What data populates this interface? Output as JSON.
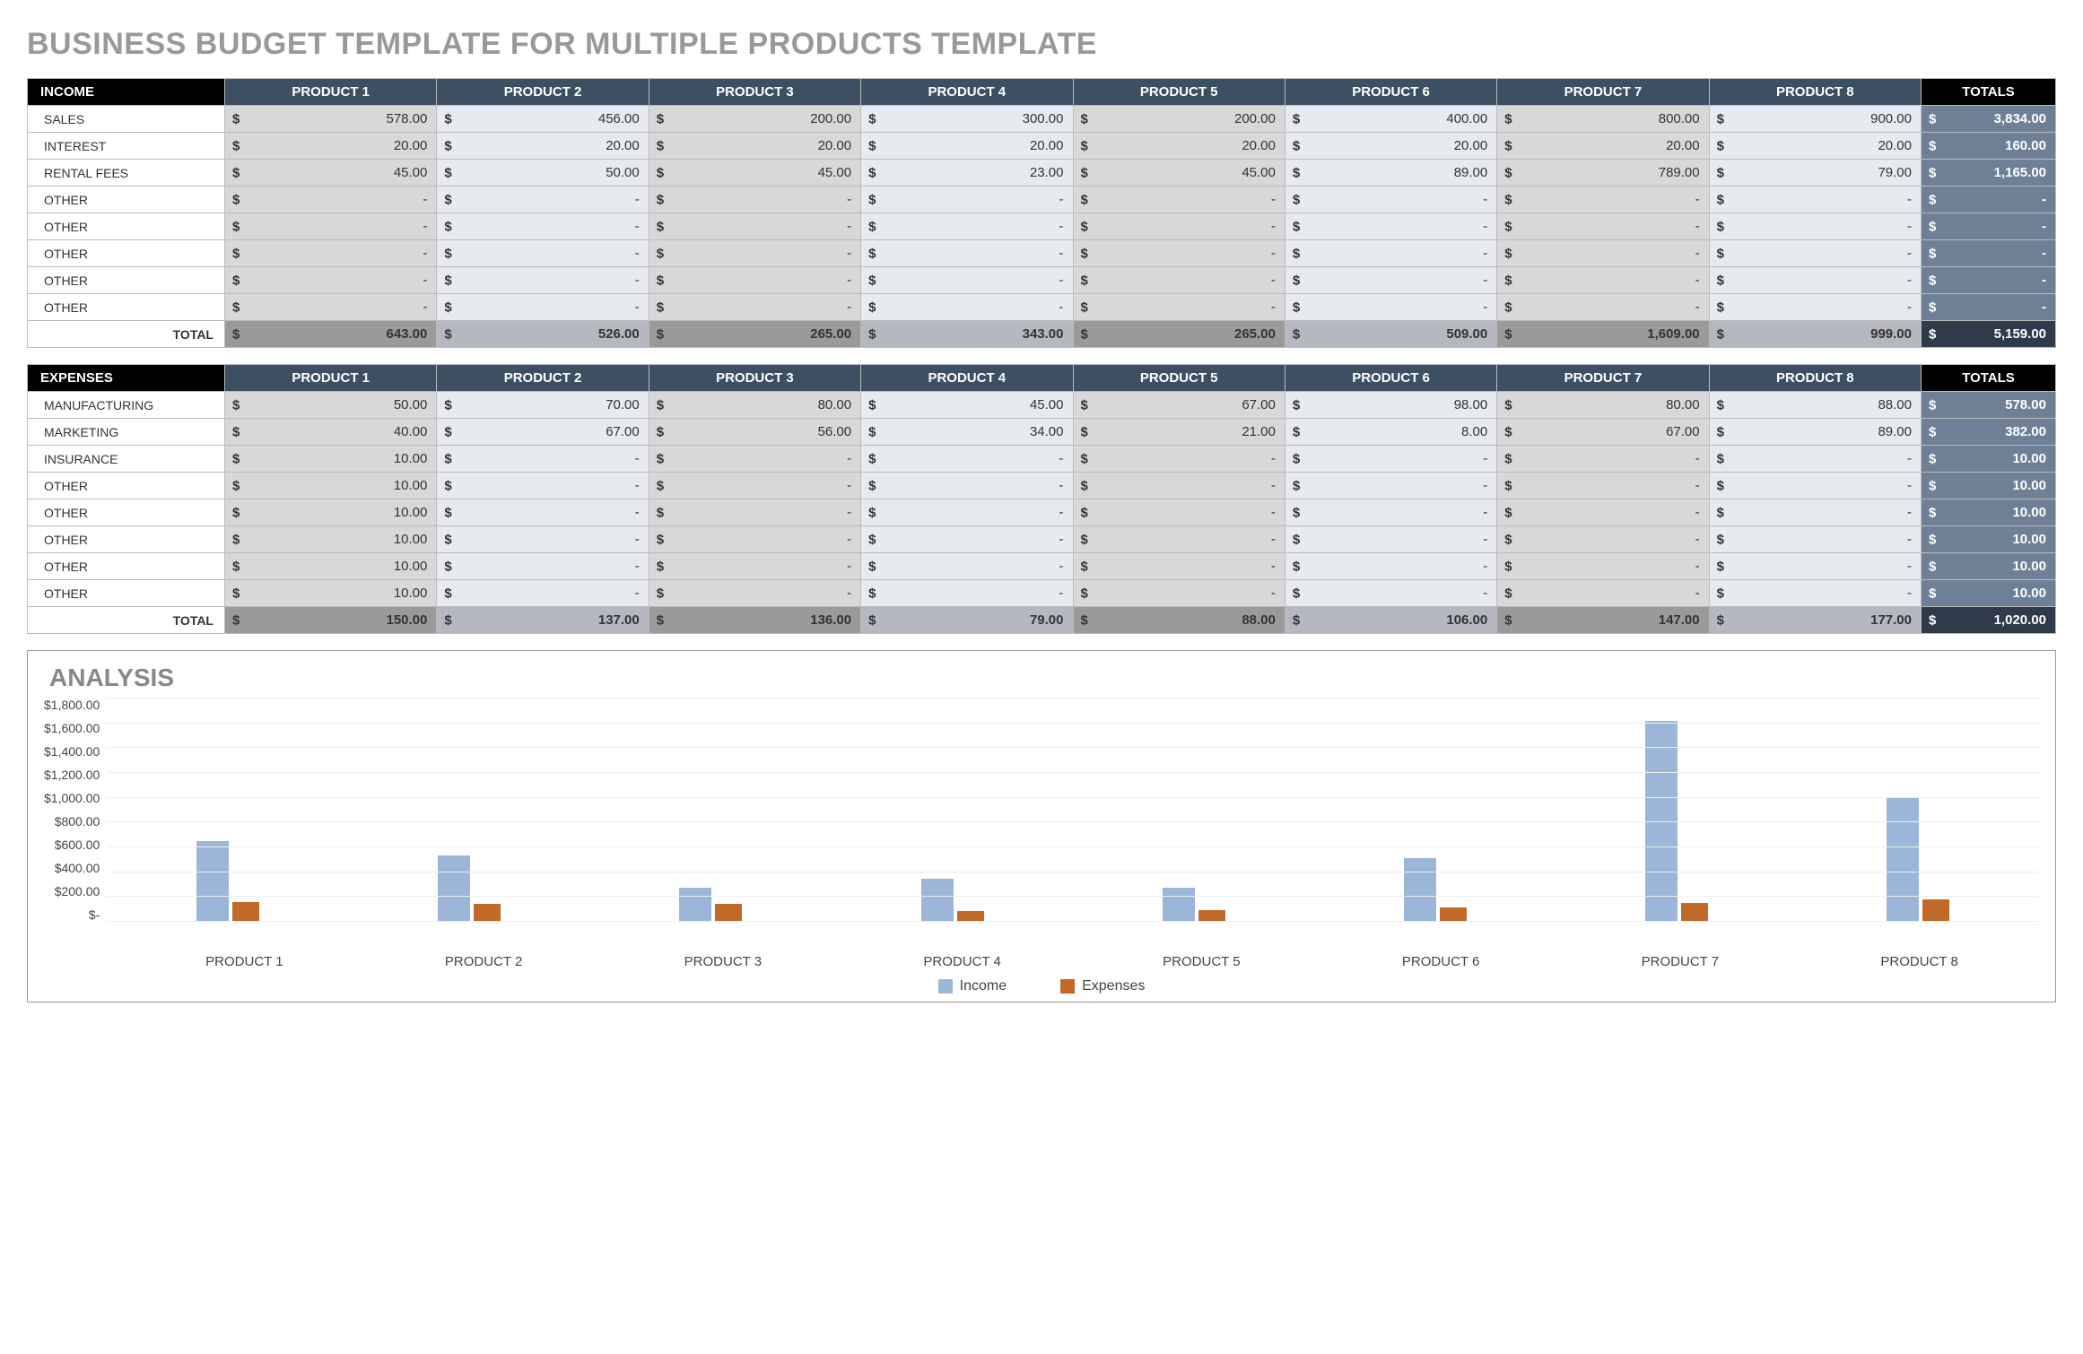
{
  "title": "BUSINESS BUDGET TEMPLATE FOR MULTIPLE PRODUCTS TEMPLATE",
  "currency": "$",
  "products": [
    "PRODUCT 1",
    "PRODUCT 2",
    "PRODUCT 3",
    "PRODUCT 4",
    "PRODUCT 5",
    "PRODUCT 6",
    "PRODUCT 7",
    "PRODUCT 8"
  ],
  "totals_label": "TOTALS",
  "total_row_label": "TOTAL",
  "income": {
    "section_label": "INCOME",
    "rows": [
      {
        "label": "SALES",
        "v": [
          "578.00",
          "456.00",
          "200.00",
          "300.00",
          "200.00",
          "400.00",
          "800.00",
          "900.00"
        ],
        "t": "3,834.00"
      },
      {
        "label": "INTEREST",
        "v": [
          "20.00",
          "20.00",
          "20.00",
          "20.00",
          "20.00",
          "20.00",
          "20.00",
          "20.00"
        ],
        "t": "160.00"
      },
      {
        "label": "RENTAL FEES",
        "v": [
          "45.00",
          "50.00",
          "45.00",
          "23.00",
          "45.00",
          "89.00",
          "789.00",
          "79.00"
        ],
        "t": "1,165.00"
      },
      {
        "label": "OTHER",
        "v": [
          "-",
          "-",
          "-",
          "-",
          "-",
          "-",
          "-",
          "-"
        ],
        "t": "-"
      },
      {
        "label": "OTHER",
        "v": [
          "-",
          "-",
          "-",
          "-",
          "-",
          "-",
          "-",
          "-"
        ],
        "t": "-"
      },
      {
        "label": "OTHER",
        "v": [
          "-",
          "-",
          "-",
          "-",
          "-",
          "-",
          "-",
          "-"
        ],
        "t": "-"
      },
      {
        "label": "OTHER",
        "v": [
          "-",
          "-",
          "-",
          "-",
          "-",
          "-",
          "-",
          "-"
        ],
        "t": "-"
      },
      {
        "label": "OTHER",
        "v": [
          "-",
          "-",
          "-",
          "-",
          "-",
          "-",
          "-",
          "-"
        ],
        "t": "-"
      }
    ],
    "totals": {
      "v": [
        "643.00",
        "526.00",
        "265.00",
        "343.00",
        "265.00",
        "509.00",
        "1,609.00",
        "999.00"
      ],
      "t": "5,159.00"
    }
  },
  "expenses": {
    "section_label": "EXPENSES",
    "rows": [
      {
        "label": "MANUFACTURING",
        "v": [
          "50.00",
          "70.00",
          "80.00",
          "45.00",
          "67.00",
          "98.00",
          "80.00",
          "88.00"
        ],
        "t": "578.00"
      },
      {
        "label": "MARKETING",
        "v": [
          "40.00",
          "67.00",
          "56.00",
          "34.00",
          "21.00",
          "8.00",
          "67.00",
          "89.00"
        ],
        "t": "382.00"
      },
      {
        "label": "INSURANCE",
        "v": [
          "10.00",
          "-",
          "-",
          "-",
          "-",
          "-",
          "-",
          "-"
        ],
        "t": "10.00"
      },
      {
        "label": "OTHER",
        "v": [
          "10.00",
          "-",
          "-",
          "-",
          "-",
          "-",
          "-",
          "-"
        ],
        "t": "10.00"
      },
      {
        "label": "OTHER",
        "v": [
          "10.00",
          "-",
          "-",
          "-",
          "-",
          "-",
          "-",
          "-"
        ],
        "t": "10.00"
      },
      {
        "label": "OTHER",
        "v": [
          "10.00",
          "-",
          "-",
          "-",
          "-",
          "-",
          "-",
          "-"
        ],
        "t": "10.00"
      },
      {
        "label": "OTHER",
        "v": [
          "10.00",
          "-",
          "-",
          "-",
          "-",
          "-",
          "-",
          "-"
        ],
        "t": "10.00"
      },
      {
        "label": "OTHER",
        "v": [
          "10.00",
          "-",
          "-",
          "-",
          "-",
          "-",
          "-",
          "-"
        ],
        "t": "10.00"
      }
    ],
    "totals": {
      "v": [
        "150.00",
        "137.00",
        "136.00",
        "79.00",
        "88.00",
        "106.00",
        "147.00",
        "177.00"
      ],
      "t": "1,020.00"
    }
  },
  "chart_data": {
    "type": "bar",
    "title": "ANALYSIS",
    "ylabel": "",
    "xlabel": "",
    "ylim": [
      0,
      1800
    ],
    "yticks": [
      "$1,800.00",
      "$1,600.00",
      "$1,400.00",
      "$1,200.00",
      "$1,000.00",
      "$800.00",
      "$600.00",
      "$400.00",
      "$200.00",
      "$-"
    ],
    "categories": [
      "PRODUCT 1",
      "PRODUCT 2",
      "PRODUCT 3",
      "PRODUCT 4",
      "PRODUCT 5",
      "PRODUCT 6",
      "PRODUCT 7",
      "PRODUCT 8"
    ],
    "series": [
      {
        "name": "Income",
        "values": [
          643,
          526,
          265,
          343,
          265,
          509,
          1609,
          999
        ]
      },
      {
        "name": "Expenses",
        "values": [
          150,
          137,
          136,
          79,
          88,
          106,
          147,
          177
        ]
      }
    ]
  }
}
